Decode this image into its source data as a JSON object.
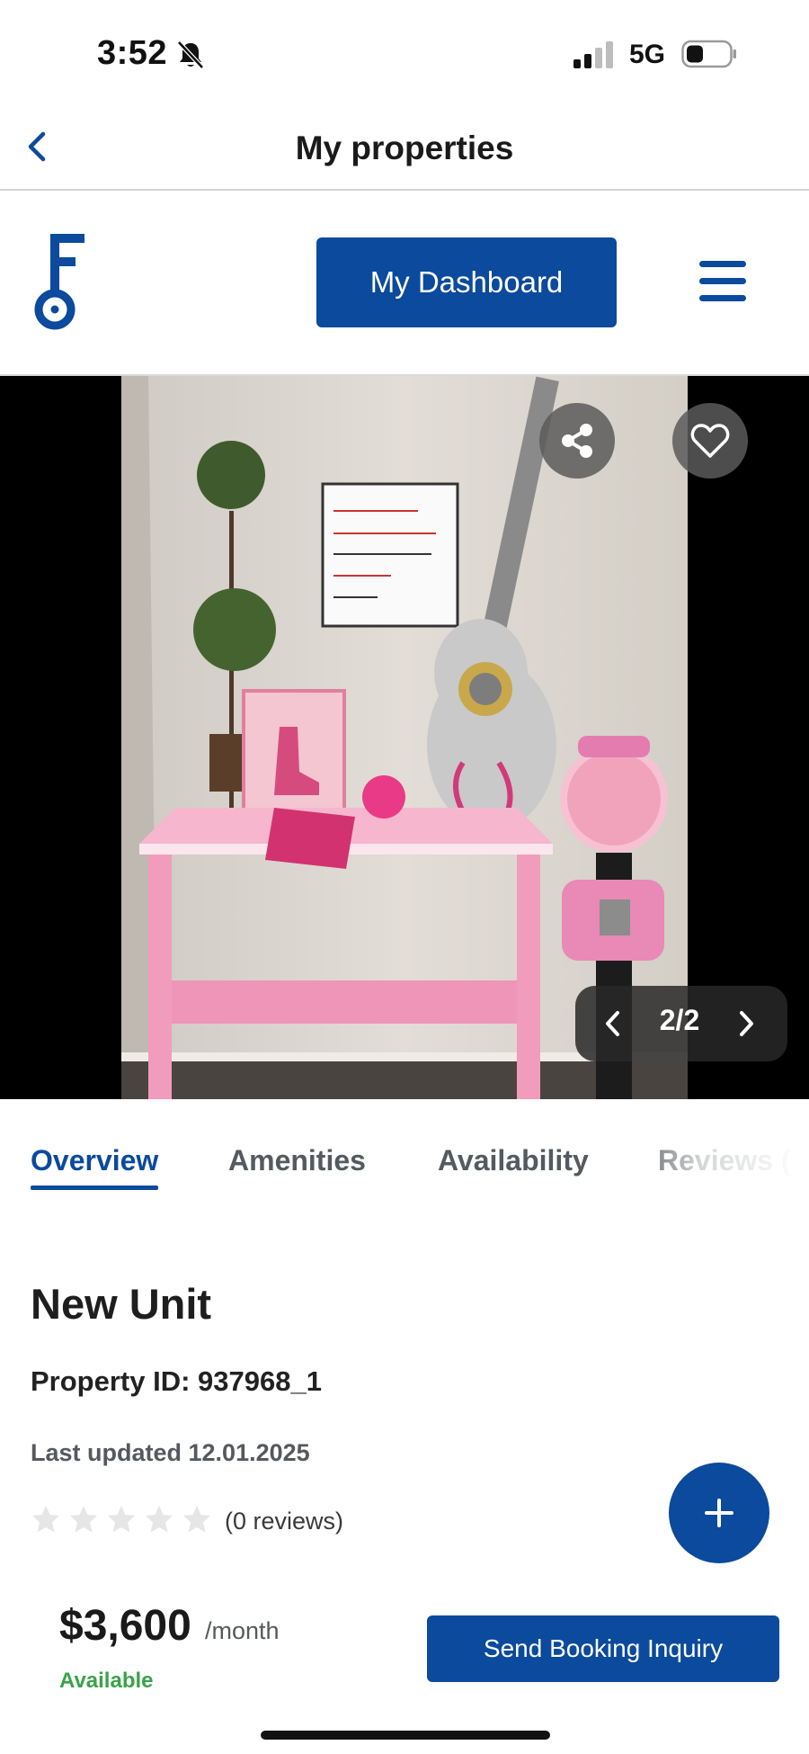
{
  "status_bar": {
    "time": "3:52",
    "network": "5G",
    "icons": [
      "bell-off-icon",
      "signal-icon",
      "battery-icon"
    ]
  },
  "nav": {
    "title": "My properties",
    "back_icon": "chevron-left-icon"
  },
  "header": {
    "logo_icon": "key-logo-icon",
    "dashboard_label": "My Dashboard",
    "menu_icon": "hamburger-menu-icon"
  },
  "gallery": {
    "counter": "2/2",
    "share_icon": "share-icon",
    "favorite_icon": "heart-icon",
    "photo_alt": "Room photo"
  },
  "tabs": [
    {
      "label": "Overview",
      "active": true
    },
    {
      "label": "Amenities",
      "active": false
    },
    {
      "label": "Availability",
      "active": false
    },
    {
      "label": "Reviews (",
      "active": false
    }
  ],
  "listing": {
    "title": "New Unit",
    "property_id": "Property ID: 937968_1",
    "last_updated": "Last updated 12.01.2025",
    "rating": 0,
    "rating_max": 5,
    "reviews": "(0 reviews)"
  },
  "booking": {
    "price": "$3,600",
    "period": "/month",
    "availability": "Available",
    "inquiry_label": "Send Booking Inquiry"
  },
  "colors": {
    "brand": "#0b4a9c",
    "available": "#3aa24a"
  }
}
